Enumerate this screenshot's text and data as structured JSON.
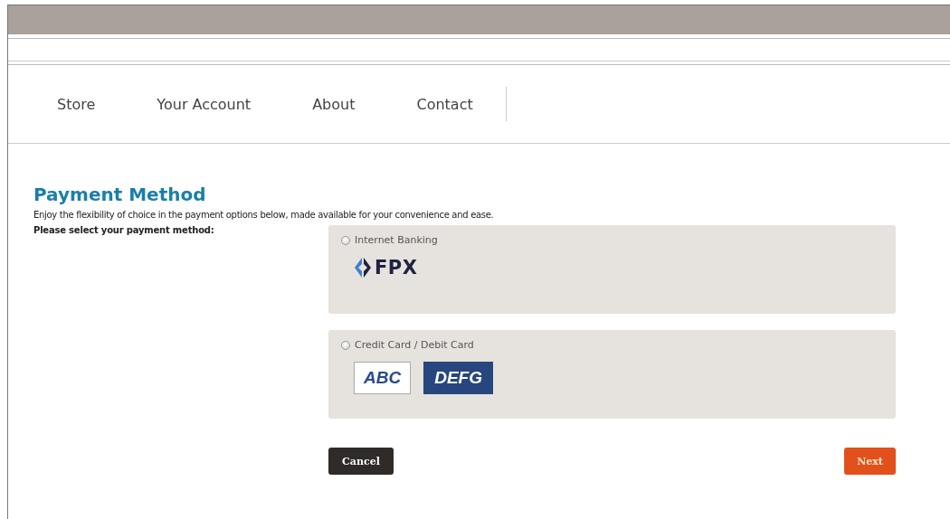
{
  "nav": {
    "items": [
      {
        "label": "Store"
      },
      {
        "label": "Your Account"
      },
      {
        "label": "About"
      },
      {
        "label": "Contact"
      }
    ]
  },
  "payment": {
    "title": "Payment Method",
    "description": "Enjoy the flexibility of choice in the payment options below, made available for your convenience and ease.",
    "prompt": "Please select your payment method:",
    "options": [
      {
        "label": "Internet Banking",
        "selected": false,
        "logos": [
          {
            "kind": "fpx",
            "text": "FPX"
          }
        ]
      },
      {
        "label": "Credit Card / Debit Card",
        "selected": false,
        "logos": [
          {
            "kind": "outlined",
            "text": "ABC"
          },
          {
            "kind": "filled",
            "text": "DEFG"
          }
        ]
      }
    ],
    "buttons": [
      {
        "kind": "secondary",
        "label": "Cancel"
      },
      {
        "kind": "primary",
        "label": "Next"
      }
    ]
  }
}
